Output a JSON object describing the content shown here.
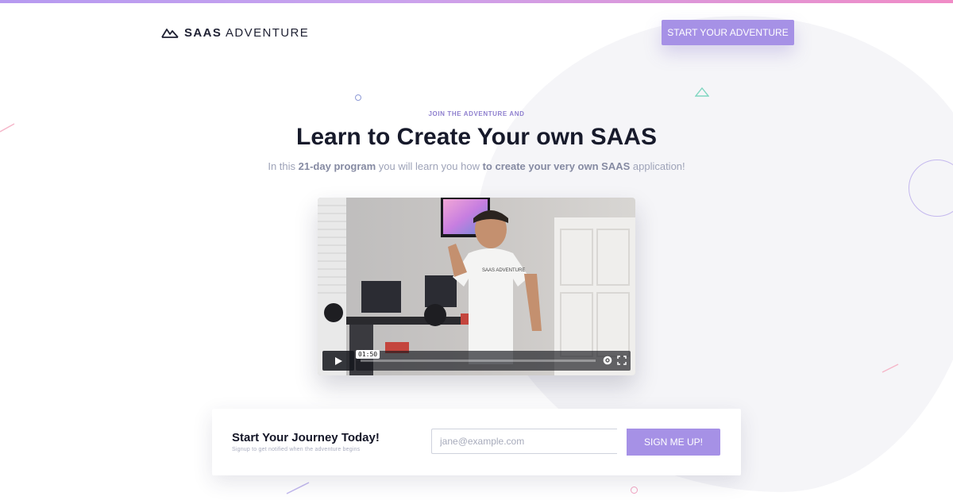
{
  "colors": {
    "accent": "#a691e6",
    "heading": "#171a2b",
    "muted": "#9ea3b8",
    "eyebrow": "#8f80cf",
    "top_gradient_start": "#b69af0",
    "top_gradient_end": "#f08cc6"
  },
  "header": {
    "logo_icon": "mountains-icon",
    "brand_bold": "SAAS",
    "brand_light": "ADVENTURE",
    "cta_label": "START YOUR ADVENTURE"
  },
  "hero": {
    "eyebrow": "JOIN THE ADVENTURE AND",
    "title": "Learn to Create Your own SAAS",
    "sub_1": "In this ",
    "sub_2": "21-day program",
    "sub_3": " you will learn you how ",
    "sub_4": "to create your very own SAAS",
    "sub_5": " application!"
  },
  "video": {
    "time": "01:50",
    "shirt_text": "SAAS ADVENTURE",
    "play_icon": "play-icon",
    "settings_icon": "gear-icon",
    "fullscreen_icon": "fullscreen-icon"
  },
  "signup": {
    "title": "Start Your Journey Today!",
    "subtitle": "Signup to get notified when the adventure begins",
    "email_placeholder": "jane@example.com",
    "email_value": "",
    "button_label": "SIGN ME UP!"
  }
}
